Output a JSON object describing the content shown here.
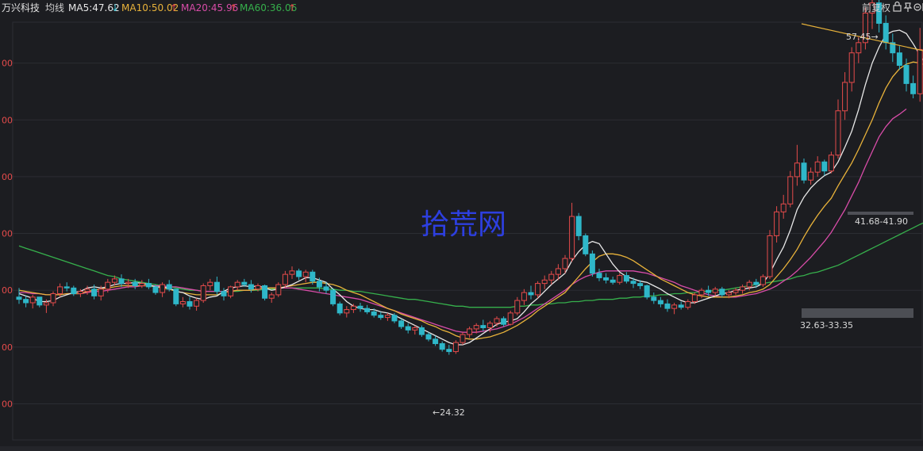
{
  "header": {
    "stock_name": "万兴科技",
    "mode_label": "均线",
    "ma5": "MA5:47.62",
    "ma5_arrow": "↓",
    "ma10": "MA10:50.02",
    "ma10_arrow": "↑",
    "ma20": "MA20:45.96",
    "ma20_arrow": "↑",
    "ma60": "MA60:36.06",
    "ma60_arrow": "↑",
    "adjust_label": "前复权",
    "icons": [
      "lock-icon",
      "pin-icon",
      "zoom-minus-icon",
      "zoom-plus-icon"
    ]
  },
  "watermark": "拾荒网",
  "colors": {
    "background": "#1c1d21",
    "up": "#e54b4b",
    "down": "#2fb7c9",
    "ma5": "#e8e8e8",
    "ma10": "#e8b23a",
    "ma20": "#d84ca8",
    "ma60": "#36b04c",
    "trendline": "#e8b23a",
    "watermark": "#2d3fe0",
    "grid": "#2b2d33",
    "zone": "#55575d"
  },
  "chart_data": {
    "type": "candlestick",
    "ylim": [
      15,
      60
    ],
    "y_ticks": [
      20,
      25,
      30,
      35,
      40,
      45,
      50,
      55
    ],
    "y_tick_labels": [
      "00",
      "00",
      "00",
      "00",
      "00",
      "00",
      "00"
    ],
    "grid": "horizontal",
    "price_labels": [
      {
        "text": "57.45→",
        "value": 57.45
      },
      {
        "text": "←24.32",
        "value": 24.32
      },
      {
        "text": "41.68-41.90",
        "value": 41.8
      },
      {
        "text": "32.63-33.35",
        "value": 33.0
      }
    ],
    "zones": [
      {
        "low": 41.68,
        "high": 41.9
      },
      {
        "low": 32.63,
        "high": 33.35
      }
    ],
    "trendline": [
      {
        "x": 141,
        "y": 55.7
      },
      {
        "x": 161,
        "y": 47.3
      }
    ],
    "ohlc": [
      [
        29.4,
        30.2,
        28.8,
        29.2
      ],
      [
        29.2,
        29.5,
        28.5,
        28.9
      ],
      [
        28.9,
        29.6,
        28.4,
        29.4
      ],
      [
        29.4,
        29.4,
        28.5,
        28.7
      ],
      [
        28.7,
        29.2,
        28.0,
        28.9
      ],
      [
        28.9,
        29.9,
        28.6,
        29.7
      ],
      [
        29.7,
        30.6,
        29.4,
        30.3
      ],
      [
        30.3,
        30.7,
        29.9,
        30.2
      ],
      [
        30.2,
        30.4,
        29.5,
        29.7
      ],
      [
        29.7,
        30.1,
        29.4,
        29.9
      ],
      [
        29.9,
        30.4,
        29.6,
        30.1
      ],
      [
        30.1,
        30.5,
        29.2,
        29.5
      ],
      [
        29.5,
        30.4,
        29.1,
        30.1
      ],
      [
        30.1,
        31.0,
        29.8,
        30.7
      ],
      [
        30.7,
        31.3,
        30.4,
        31.0
      ],
      [
        31.0,
        31.4,
        30.3,
        30.6
      ],
      [
        30.6,
        31.0,
        30.2,
        30.7
      ],
      [
        30.7,
        31.0,
        30.1,
        30.4
      ],
      [
        30.4,
        30.9,
        30.2,
        30.6
      ],
      [
        30.6,
        31.0,
        30.1,
        30.3
      ],
      [
        30.3,
        30.5,
        29.6,
        29.8
      ],
      [
        29.8,
        30.7,
        29.4,
        30.5
      ],
      [
        30.5,
        30.9,
        29.9,
        30.1
      ],
      [
        30.1,
        30.1,
        28.6,
        28.8
      ],
      [
        28.8,
        29.4,
        28.5,
        29.0
      ],
      [
        29.0,
        29.4,
        28.3,
        28.6
      ],
      [
        28.6,
        29.3,
        28.2,
        29.1
      ],
      [
        29.1,
        30.6,
        28.9,
        30.4
      ],
      [
        30.4,
        31.0,
        30.0,
        30.7
      ],
      [
        30.7,
        31.2,
        29.6,
        29.9
      ],
      [
        29.9,
        30.2,
        29.1,
        29.5
      ],
      [
        29.5,
        30.4,
        29.3,
        30.3
      ],
      [
        30.3,
        30.9,
        30.0,
        30.7
      ],
      [
        30.7,
        31.0,
        30.3,
        30.5
      ],
      [
        30.5,
        30.9,
        29.8,
        30.1
      ],
      [
        30.1,
        30.6,
        29.9,
        30.4
      ],
      [
        30.4,
        30.5,
        29.1,
        29.3
      ],
      [
        29.3,
        29.8,
        28.9,
        29.6
      ],
      [
        29.6,
        30.7,
        29.4,
        30.5
      ],
      [
        30.5,
        31.7,
        30.2,
        31.4
      ],
      [
        31.4,
        32.1,
        31.0,
        31.7
      ],
      [
        31.7,
        31.9,
        30.9,
        31.2
      ],
      [
        31.2,
        31.8,
        30.7,
        31.6
      ],
      [
        31.6,
        31.8,
        30.5,
        30.8
      ],
      [
        30.8,
        31.1,
        29.9,
        30.3
      ],
      [
        30.3,
        30.7,
        29.7,
        30.0
      ],
      [
        30.0,
        30.2,
        28.6,
        28.8
      ],
      [
        28.8,
        29.0,
        27.8,
        28.0
      ],
      [
        28.0,
        28.6,
        27.6,
        28.3
      ],
      [
        28.3,
        28.8,
        28.0,
        28.6
      ],
      [
        28.6,
        28.9,
        28.1,
        28.4
      ],
      [
        28.4,
        28.7,
        27.9,
        28.1
      ],
      [
        28.1,
        28.4,
        27.6,
        27.8
      ],
      [
        27.8,
        28.1,
        27.4,
        27.6
      ],
      [
        27.6,
        28.0,
        27.3,
        27.8
      ],
      [
        27.8,
        28.0,
        27.1,
        27.3
      ],
      [
        27.3,
        27.5,
        26.6,
        26.8
      ],
      [
        26.8,
        27.1,
        26.2,
        26.5
      ],
      [
        26.5,
        26.9,
        26.1,
        26.7
      ],
      [
        26.7,
        26.9,
        25.9,
        26.1
      ],
      [
        26.1,
        26.3,
        25.5,
        25.7
      ],
      [
        25.7,
        26.0,
        25.1,
        25.3
      ],
      [
        25.3,
        25.5,
        24.6,
        24.8
      ],
      [
        24.8,
        25.2,
        24.32,
        24.6
      ],
      [
        24.6,
        25.6,
        24.4,
        25.4
      ],
      [
        25.4,
        26.3,
        25.2,
        26.1
      ],
      [
        26.1,
        26.8,
        25.8,
        26.6
      ],
      [
        26.6,
        27.1,
        26.2,
        26.9
      ],
      [
        26.9,
        27.4,
        26.4,
        26.7
      ],
      [
        26.7,
        27.3,
        26.3,
        27.1
      ],
      [
        27.1,
        27.7,
        26.8,
        27.5
      ],
      [
        27.5,
        27.7,
        26.8,
        27.0
      ],
      [
        27.0,
        28.2,
        26.9,
        28.0
      ],
      [
        28.0,
        29.4,
        27.8,
        29.1
      ],
      [
        29.1,
        30.1,
        28.7,
        29.8
      ],
      [
        29.8,
        30.4,
        29.2,
        29.6
      ],
      [
        29.6,
        30.8,
        29.3,
        30.6
      ],
      [
        30.6,
        31.3,
        30.1,
        30.9
      ],
      [
        30.9,
        31.7,
        30.5,
        31.4
      ],
      [
        31.4,
        32.3,
        30.9,
        31.9
      ],
      [
        31.9,
        33.1,
        31.5,
        32.8
      ],
      [
        32.8,
        37.7,
        32.5,
        36.5
      ],
      [
        36.5,
        36.8,
        34.4,
        34.8
      ],
      [
        34.8,
        35.0,
        33.0,
        33.2
      ],
      [
        33.2,
        33.5,
        31.2,
        31.5
      ],
      [
        31.5,
        31.9,
        30.8,
        31.1
      ],
      [
        31.1,
        31.5,
        30.6,
        30.9
      ],
      [
        30.9,
        31.2,
        30.5,
        30.7
      ],
      [
        30.7,
        31.5,
        30.5,
        31.3
      ],
      [
        31.3,
        31.6,
        30.6,
        30.8
      ],
      [
        30.8,
        31.1,
        30.2,
        30.6
      ],
      [
        30.6,
        30.9,
        30.1,
        30.4
      ],
      [
        30.4,
        30.5,
        29.2,
        29.4
      ],
      [
        29.4,
        29.8,
        28.8,
        29.1
      ],
      [
        29.1,
        29.4,
        28.5,
        28.8
      ],
      [
        28.8,
        29.2,
        28.1,
        28.4
      ],
      [
        28.4,
        28.9,
        27.9,
        28.7
      ],
      [
        28.7,
        29.0,
        28.3,
        28.5
      ],
      [
        28.5,
        29.2,
        28.3,
        29.0
      ],
      [
        29.0,
        29.8,
        28.8,
        29.6
      ],
      [
        29.6,
        30.2,
        29.3,
        30.0
      ],
      [
        30.0,
        30.4,
        29.5,
        29.8
      ],
      [
        29.8,
        30.3,
        29.5,
        30.1
      ],
      [
        30.1,
        30.3,
        29.4,
        29.6
      ],
      [
        29.6,
        30.0,
        29.3,
        29.8
      ],
      [
        29.8,
        30.2,
        29.6,
        30.0
      ],
      [
        30.0,
        30.5,
        29.7,
        30.3
      ],
      [
        30.3,
        30.9,
        30.0,
        30.7
      ],
      [
        30.7,
        31.0,
        30.2,
        30.5
      ],
      [
        30.5,
        31.4,
        30.3,
        31.2
      ],
      [
        31.2,
        35.3,
        31.0,
        34.8
      ],
      [
        34.8,
        37.4,
        34.2,
        36.9
      ],
      [
        36.9,
        38.4,
        36.3,
        37.6
      ],
      [
        37.6,
        40.5,
        37.3,
        40.0
      ],
      [
        40.0,
        42.8,
        39.2,
        41.2
      ],
      [
        41.2,
        41.6,
        39.4,
        39.7
      ],
      [
        39.7,
        40.8,
        39.3,
        40.4
      ],
      [
        40.4,
        41.8,
        40.0,
        41.3
      ],
      [
        41.3,
        41.5,
        40.1,
        40.5
      ],
      [
        40.5,
        42.2,
        40.3,
        41.9
      ],
      [
        41.9,
        46.8,
        41.6,
        45.8
      ],
      [
        45.8,
        49.2,
        45.0,
        48.3
      ],
      [
        48.3,
        51.4,
        47.5,
        50.9
      ],
      [
        50.9,
        52.3,
        50.0,
        51.8
      ],
      [
        51.8,
        54.9,
        51.2,
        54.4
      ],
      [
        54.4,
        57.45,
        53.0,
        55.3
      ],
      [
        55.3,
        56.0,
        52.7,
        53.5
      ],
      [
        53.5,
        54.2,
        51.2,
        51.8
      ],
      [
        51.8,
        52.6,
        50.1,
        50.9
      ],
      [
        50.9,
        51.5,
        49.4,
        49.8
      ],
      [
        49.8,
        50.4,
        47.5,
        48.2
      ],
      [
        48.2,
        48.9,
        46.9,
        47.3
      ],
      [
        47.3,
        53.1,
        46.6,
        51.2
      ]
    ],
    "ma5": [
      29.7,
      29.5,
      29.3,
      29.0,
      29.0,
      29.1,
      29.4,
      29.6,
      29.8,
      29.9,
      30.2,
      30.3,
      30.2,
      30.3,
      30.5,
      30.6,
      30.6,
      30.7,
      30.6,
      30.5,
      30.3,
      30.3,
      30.2,
      29.9,
      29.8,
      29.5,
      29.3,
      29.2,
      29.4,
      29.5,
      29.9,
      30.2,
      30.3,
      30.4,
      30.3,
      30.4,
      30.2,
      30.0,
      30.1,
      30.3,
      30.5,
      30.8,
      31.1,
      31.1,
      30.9,
      30.7,
      30.1,
      29.6,
      29.0,
      28.6,
      28.4,
      28.3,
      28.3,
      28.1,
      28.0,
      27.8,
      27.5,
      27.2,
      26.9,
      26.6,
      26.3,
      26.0,
      25.7,
      25.4,
      25.2,
      25.2,
      25.4,
      25.8,
      26.2,
      26.6,
      27.0,
      27.2,
      27.3,
      27.5,
      28.1,
      28.8,
      29.3,
      29.9,
      30.5,
      31.0,
      31.5,
      32.6,
      33.4,
      34.0,
      34.3,
      34.1,
      33.2,
      32.3,
      31.6,
      31.2,
      31.0,
      30.8,
      30.7,
      30.4,
      30.1,
      29.7,
      29.4,
      29.1,
      28.9,
      28.9,
      29.1,
      29.3,
      29.5,
      29.7,
      29.8,
      30.0,
      30.1,
      30.2,
      30.3,
      30.6,
      31.5,
      32.7,
      33.8,
      35.3,
      37.1,
      38.2,
      39.0,
      39.6,
      40.1,
      40.4,
      41.3,
      42.6,
      44.0,
      45.9,
      48.1,
      50.0,
      51.4,
      52.5,
      52.8,
      52.9,
      52.6,
      51.7,
      50.7,
      49.8,
      49.3
    ],
    "ma10": [
      30.0,
      29.9,
      29.8,
      29.7,
      29.6,
      29.6,
      29.6,
      29.7,
      29.7,
      29.7,
      29.9,
      30.0,
      30.1,
      30.2,
      30.3,
      30.4,
      30.4,
      30.4,
      30.4,
      30.4,
      30.3,
      30.2,
      30.1,
      29.9,
      29.8,
      29.7,
      29.6,
      29.6,
      29.6,
      29.6,
      29.8,
      29.9,
      30.0,
      30.0,
      30.0,
      30.1,
      30.2,
      30.2,
      30.2,
      30.3,
      30.4,
      30.5,
      30.6,
      30.7,
      30.7,
      30.6,
      30.5,
      30.3,
      30.0,
      29.8,
      29.6,
      29.3,
      29.0,
      28.7,
      28.4,
      28.2,
      27.9,
      27.7,
      27.5,
      27.3,
      27.0,
      26.8,
      26.5,
      26.3,
      26.0,
      25.8,
      25.7,
      25.7,
      25.8,
      25.9,
      26.1,
      26.3,
      26.6,
      26.9,
      27.3,
      27.7,
      28.2,
      28.6,
      29.0,
      29.4,
      29.8,
      30.5,
      31.2,
      31.9,
      32.5,
      33.0,
      33.2,
      33.2,
      33.1,
      32.9,
      32.6,
      32.2,
      31.8,
      31.4,
      31.0,
      30.7,
      30.4,
      30.1,
      29.8,
      29.6,
      29.5,
      29.4,
      29.4,
      29.4,
      29.4,
      29.5,
      29.6,
      29.8,
      29.9,
      30.1,
      30.5,
      31.2,
      31.9,
      32.7,
      33.6,
      34.7,
      35.7,
      36.6,
      37.4,
      38.1,
      39.2,
      40.2,
      41.2,
      42.4,
      43.7,
      45.0,
      46.5,
      47.8,
      48.8,
      49.5,
      49.9,
      50.1,
      50.0,
      49.8,
      50.02
    ],
    "ma20": [
      29.8,
      29.8,
      29.7,
      29.7,
      29.6,
      29.6,
      29.6,
      29.7,
      29.7,
      29.7,
      29.8,
      29.9,
      29.9,
      30.0,
      30.1,
      30.2,
      30.3,
      30.3,
      30.4,
      30.4,
      30.4,
      30.4,
      30.3,
      30.3,
      30.2,
      30.1,
      30.0,
      29.9,
      29.9,
      29.9,
      29.9,
      29.9,
      30.0,
      30.0,
      30.0,
      30.1,
      30.2,
      30.2,
      30.2,
      30.2,
      30.2,
      30.1,
      30.0,
      29.9,
      29.8,
      29.7,
      29.6,
      29.5,
      29.4,
      29.3,
      29.2,
      29.0,
      28.8,
      28.6,
      28.4,
      28.2,
      28.0,
      27.8,
      27.6,
      27.4,
      27.2,
      27.0,
      26.8,
      26.6,
      26.4,
      26.3,
      26.3,
      26.3,
      26.4,
      26.5,
      26.6,
      26.8,
      27.0,
      27.3,
      27.6,
      28.0,
      28.4,
      28.8,
      29.2,
      29.6,
      30.0,
      30.5,
      30.9,
      31.2,
      31.4,
      31.6,
      31.7,
      31.7,
      31.7,
      31.7,
      31.7,
      31.6,
      31.5,
      31.3,
      31.1,
      30.9,
      30.7,
      30.4,
      30.2,
      30.0,
      29.8,
      29.6,
      29.5,
      29.4,
      29.4,
      29.4,
      29.5,
      29.6,
      29.7,
      29.9,
      30.1,
      30.4,
      30.8,
      31.2,
      31.7,
      32.3,
      32.9,
      33.6,
      34.3,
      35.1,
      36.1,
      37.1,
      38.3,
      39.5,
      40.9,
      42.2,
      43.5,
      44.4,
      45.1,
      45.5,
      45.96
    ],
    "ma60": [
      33.9,
      33.7,
      33.5,
      33.3,
      33.1,
      32.9,
      32.7,
      32.5,
      32.3,
      32.1,
      31.9,
      31.7,
      31.5,
      31.3,
      31.2,
      31.0,
      30.9,
      30.8,
      30.7,
      30.6,
      30.5,
      30.4,
      30.3,
      30.2,
      30.1,
      30.0,
      30.0,
      29.9,
      29.9,
      29.9,
      29.9,
      29.9,
      29.9,
      30.0,
      30.0,
      30.0,
      30.1,
      30.1,
      30.2,
      30.2,
      30.2,
      30.2,
      30.2,
      30.2,
      30.2,
      30.1,
      30.1,
      30.0,
      30.0,
      29.9,
      29.9,
      29.8,
      29.7,
      29.6,
      29.5,
      29.4,
      29.3,
      29.2,
      29.2,
      29.1,
      29.0,
      28.9,
      28.8,
      28.7,
      28.6,
      28.6,
      28.5,
      28.5,
      28.5,
      28.5,
      28.5,
      28.5,
      28.5,
      28.6,
      28.6,
      28.7,
      28.7,
      28.8,
      28.8,
      28.9,
      28.9,
      29.0,
      29.0,
      29.1,
      29.1,
      29.2,
      29.2,
      29.2,
      29.3,
      29.3,
      29.4,
      29.4,
      29.5,
      29.5,
      29.6,
      29.6,
      29.7,
      29.7,
      29.8,
      29.8,
      29.9,
      29.9,
      30.0,
      30.0,
      30.1,
      30.2,
      30.3,
      30.4,
      30.5,
      30.6,
      30.7,
      30.8,
      30.9,
      31.0,
      31.2,
      31.3,
      31.5,
      31.6,
      31.8,
      32.0,
      32.2,
      32.5,
      32.8,
      33.1,
      33.4,
      33.7,
      34.0,
      34.3,
      34.6,
      34.9,
      35.2,
      35.5,
      35.8,
      36.06
    ]
  }
}
